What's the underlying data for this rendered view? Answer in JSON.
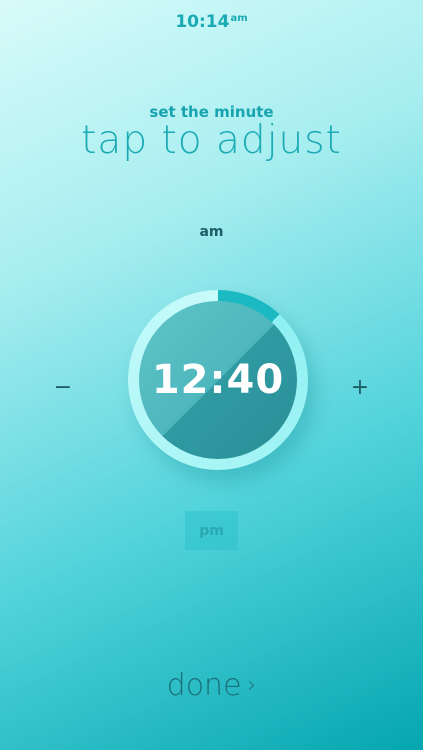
{
  "status_bar": {
    "time": "10:14",
    "ampm": "am"
  },
  "header": {
    "subtitle": "set the minute",
    "title": "tap to adjust"
  },
  "period": {
    "top_label": "am",
    "bottom_label": "pm"
  },
  "dial": {
    "value": "12:40"
  },
  "controls": {
    "minus": "−",
    "plus": "+"
  },
  "footer": {
    "done_label": "done",
    "chevron": "›"
  },
  "colors": {
    "accent": "#1caab5",
    "dial_dark": "#2a8f97",
    "text_dark": "#1d5e66"
  }
}
